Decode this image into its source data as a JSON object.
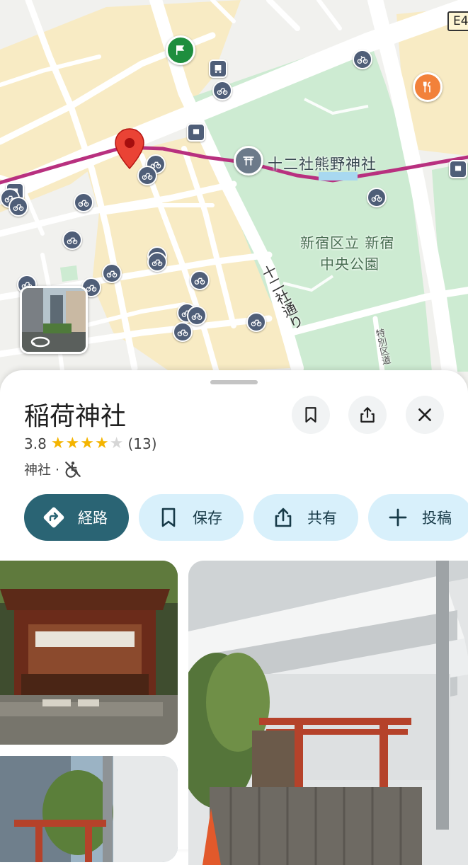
{
  "map": {
    "labels": {
      "shrine_poi": "十二社熊野神社",
      "park_line1": "新宿区立 新宿",
      "park_line2": "中央公園",
      "road_main": "十二社通り",
      "road_small": "特別区道",
      "highway": "E4"
    },
    "icons": {
      "pin": "location-pin-icon",
      "shrine": "torii-icon",
      "flag": "flag-icon",
      "restaurant": "fork-knife-icon",
      "bike": "bicycle-icon",
      "bus": "bus-icon",
      "streetview": "street-view-icon"
    },
    "colors": {
      "route": "#b8307f",
      "park": "#cdebd2",
      "residential": "#f8ebc4",
      "road": "#ffffff",
      "pin": "#ea4335"
    }
  },
  "place": {
    "title": "稲荷神社",
    "rating": "3.8",
    "stars_value": 3.8,
    "review_count": "(13)",
    "category": "神社 ·",
    "accessibility_icon": "no-wheelchair-icon"
  },
  "actions": {
    "save_icon_button": "bookmark-icon",
    "share_icon_button": "share-icon",
    "close_icon_button": "close-icon"
  },
  "chips": [
    {
      "label": "経路",
      "icon": "directions-icon"
    },
    {
      "label": "保存",
      "icon": "bookmark-icon"
    },
    {
      "label": "共有",
      "icon": "share-icon"
    },
    {
      "label": "投稿",
      "icon": "plus-icon"
    }
  ]
}
